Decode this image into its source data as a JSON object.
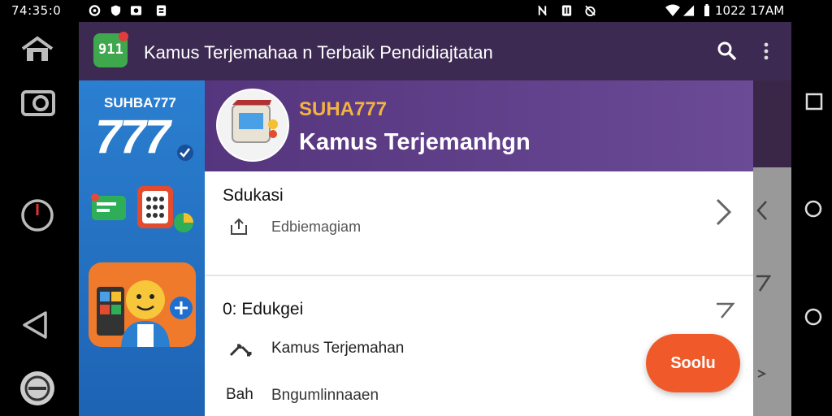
{
  "status_bar": {
    "time_left": "74:35:0",
    "time_right": "1022 17AM"
  },
  "app_bar": {
    "title": "Kamus Terjemahaa n Terbaik Pendidiajtatan",
    "icon_label": "911",
    "search_icon": "search-icon",
    "more_icon": "more-vert-icon"
  },
  "promo": {
    "brand": "SUHBA777",
    "big_number": "777",
    "colors": {
      "blue": "#2b7fd0",
      "orange": "#f07a2c"
    }
  },
  "header": {
    "name": "SUHA777",
    "subtitle": "Kamus Terjemanhgn",
    "colors": {
      "bg": "#5e3f8a",
      "name": "#f3b340"
    }
  },
  "list": {
    "row1": {
      "title": "Sdukasi",
      "sub": "Edbiemagiam"
    },
    "row2": {
      "title": "0: Edukgei",
      "item": "Kamus Terjemahan"
    },
    "row3": {
      "prefix": "Bah",
      "item": "Bngumlinnaaen"
    }
  },
  "fab": {
    "label": "Soolu",
    "color": "#f05a2a"
  }
}
